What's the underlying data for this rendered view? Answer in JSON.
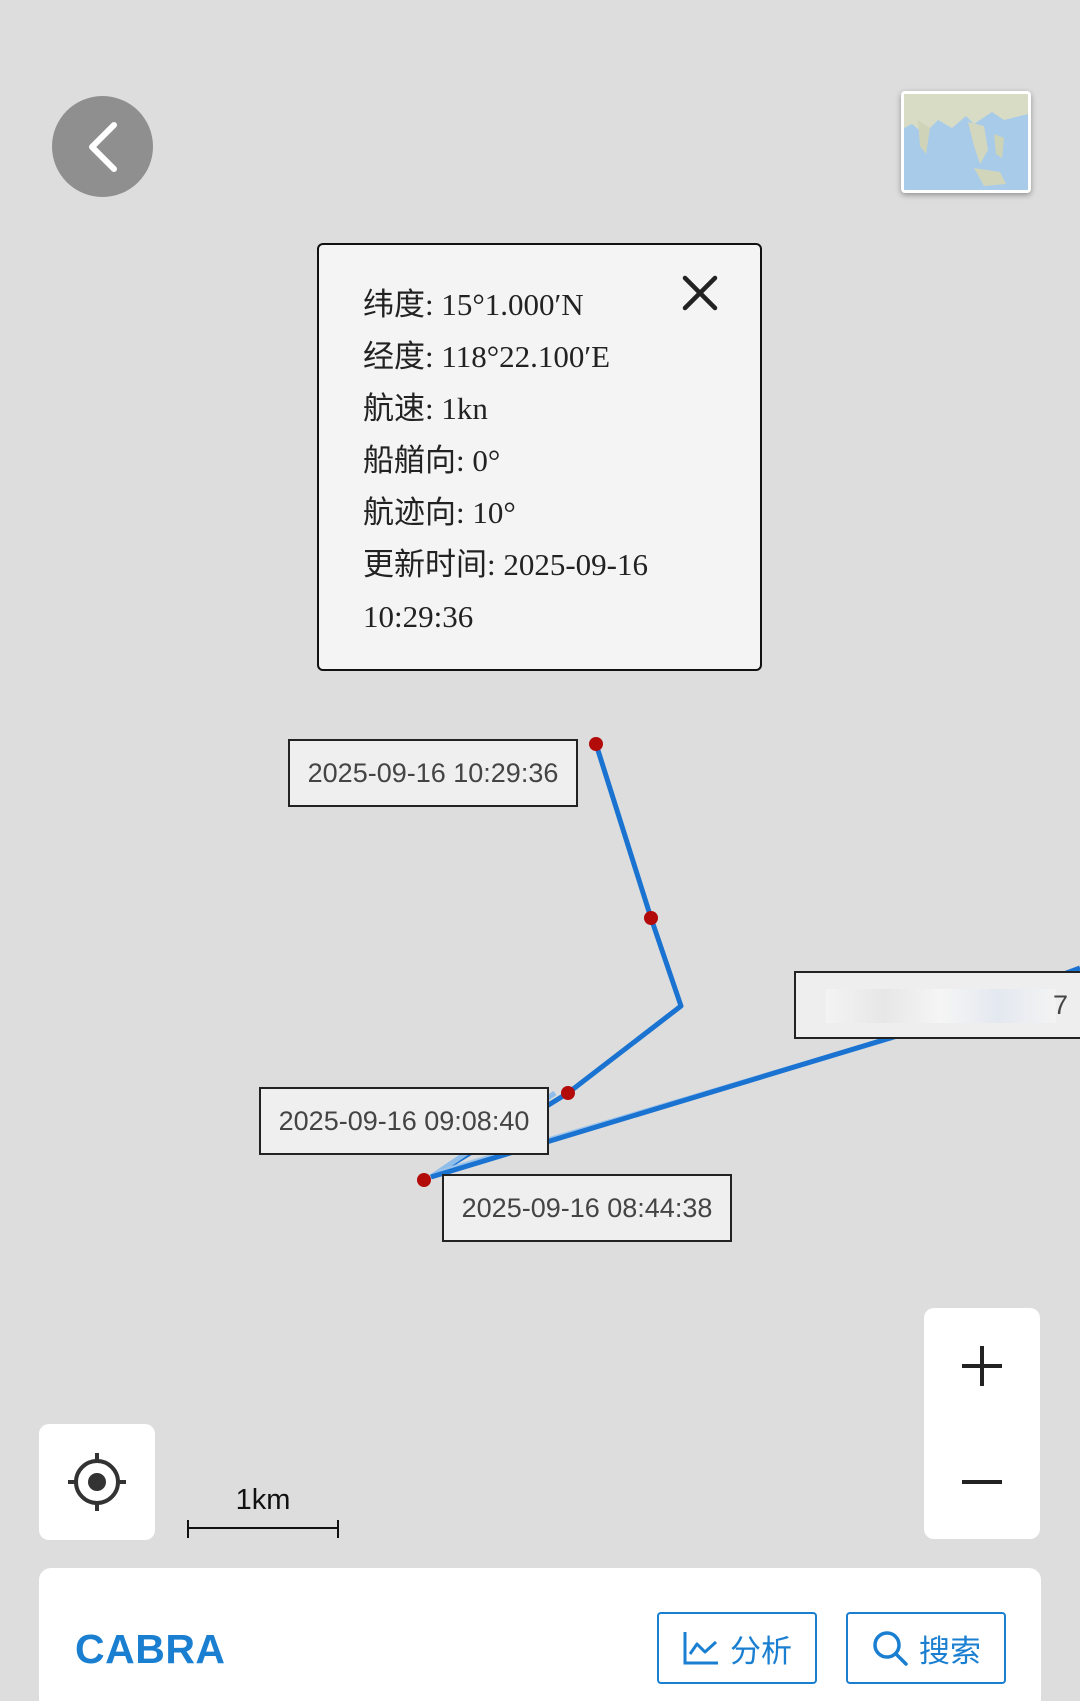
{
  "map": {
    "background": "#dddddd",
    "track_color": "#1a73d1",
    "point_color": "#b30a0a"
  },
  "info_popup": {
    "latitude": "纬度: 15°1.000′N",
    "longitude": "经度: 118°22.100′E",
    "speed": "航速: 1kn",
    "heading": "船艏向: 0°",
    "course": "航迹向: 10°",
    "updated": "更新时间: 2025-09-16 10:29:36"
  },
  "track_labels": [
    "2025-09-16 10:29:36",
    "2025-09-16 09:08:40",
    "2025-09-16 08:44:38"
  ],
  "faded_label_tail": "7",
  "scale": {
    "label": "1km"
  },
  "bottom_bar": {
    "ship_name": "CABRA",
    "analyze_label": "分析",
    "search_label": "搜索"
  },
  "icons": {
    "back": "chevron-left-icon",
    "close": "close-icon",
    "locate": "crosshair-icon",
    "zoom_in": "plus-icon",
    "zoom_out": "minus-icon",
    "analyze": "line-chart-icon",
    "search": "search-icon"
  }
}
